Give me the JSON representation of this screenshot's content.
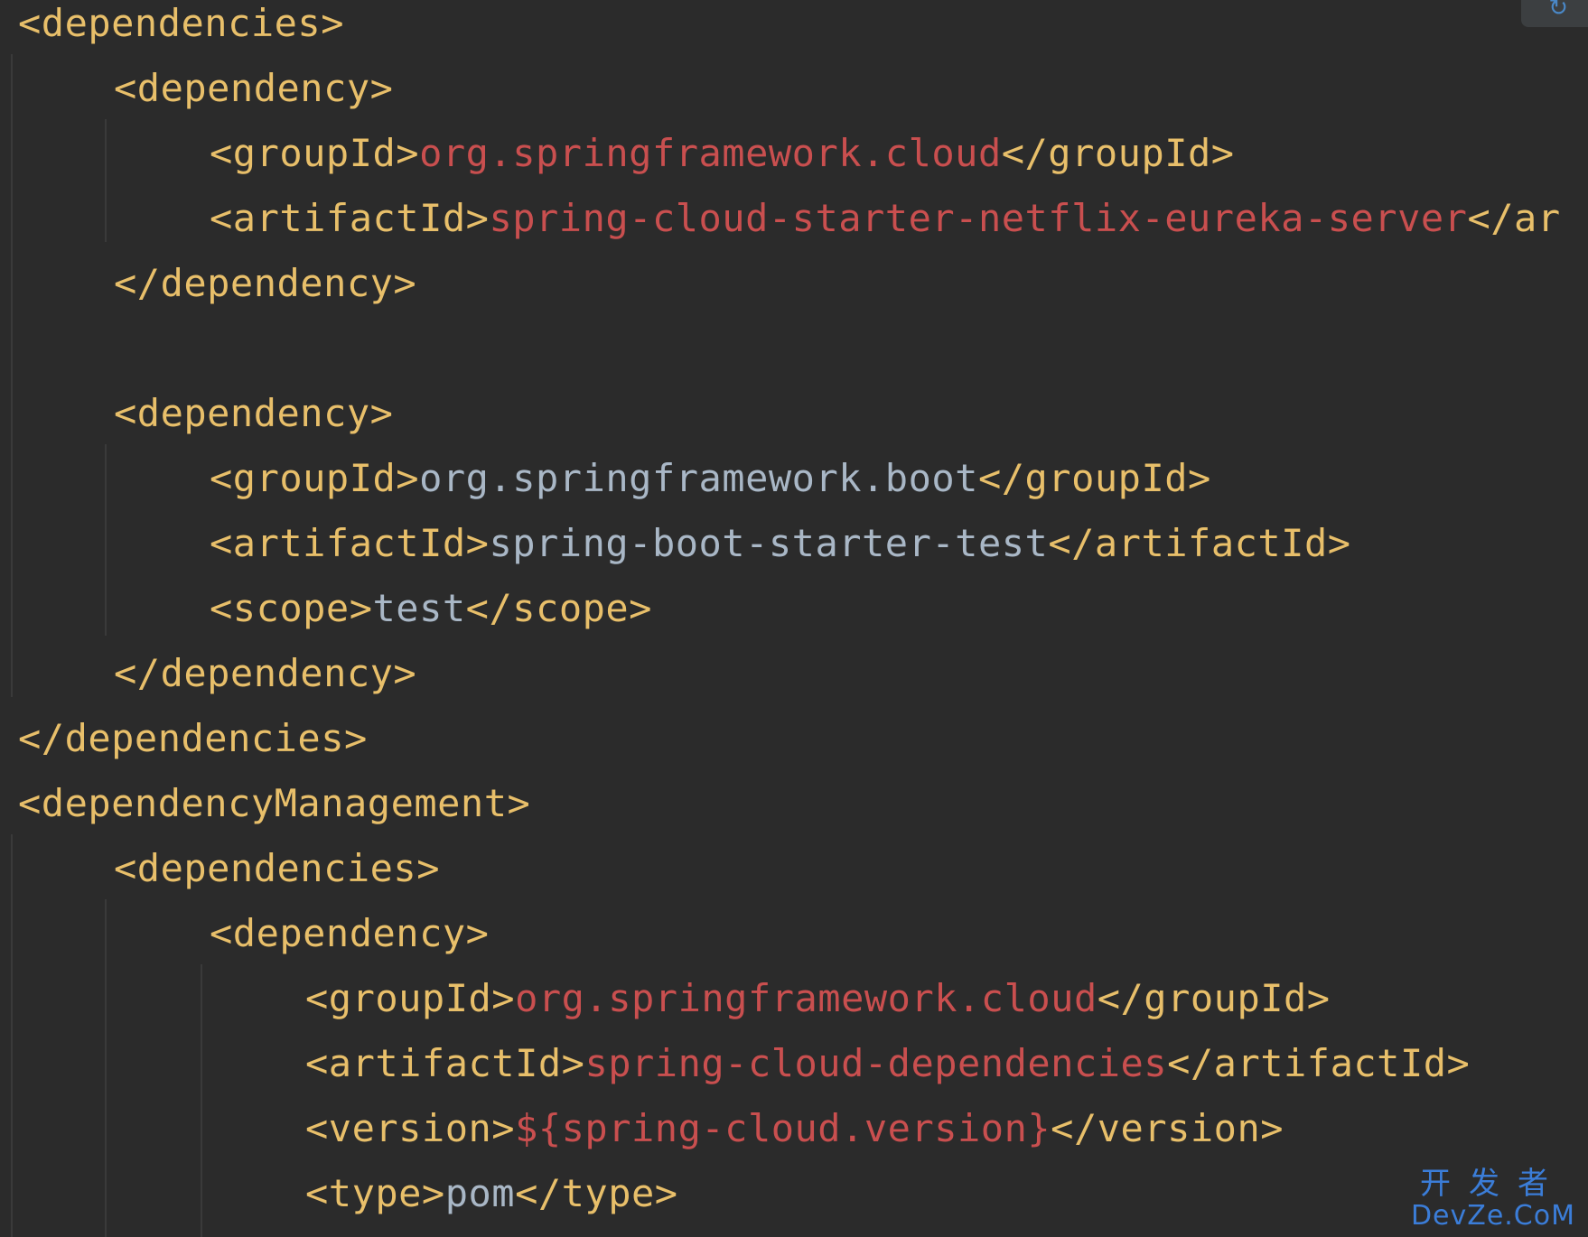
{
  "editor": {
    "colors": {
      "background": "#2b2b2b",
      "tag": "#e8bf6a",
      "unresolved": "#c94f4f",
      "text": "#a9b7c6"
    },
    "lines": [
      {
        "indent": 0,
        "parts": [
          {
            "t": "<dependencies>",
            "c": "tag"
          }
        ]
      },
      {
        "indent": 1,
        "parts": [
          {
            "t": "<dependency>",
            "c": "tag"
          }
        ]
      },
      {
        "indent": 2,
        "parts": [
          {
            "t": "<groupId>",
            "c": "tag"
          },
          {
            "t": "org.springframework.cloud",
            "c": "bad"
          },
          {
            "t": "</groupId>",
            "c": "tag"
          }
        ]
      },
      {
        "indent": 2,
        "parts": [
          {
            "t": "<artifactId>",
            "c": "tag"
          },
          {
            "t": "spring-cloud-starter-netflix-eureka-server",
            "c": "bad"
          },
          {
            "t": "</ar",
            "c": "tag"
          }
        ]
      },
      {
        "indent": 1,
        "parts": [
          {
            "t": "</dependency>",
            "c": "tag"
          }
        ]
      },
      {
        "indent": 0,
        "parts": []
      },
      {
        "indent": 1,
        "parts": [
          {
            "t": "<dependency>",
            "c": "tag"
          }
        ]
      },
      {
        "indent": 2,
        "parts": [
          {
            "t": "<groupId>",
            "c": "tag"
          },
          {
            "t": "org.springframework.boot",
            "c": "ok"
          },
          {
            "t": "</groupId>",
            "c": "tag"
          }
        ]
      },
      {
        "indent": 2,
        "parts": [
          {
            "t": "<artifactId>",
            "c": "tag"
          },
          {
            "t": "spring-boot-starter-test",
            "c": "ok"
          },
          {
            "t": "</artifactId>",
            "c": "tag"
          }
        ]
      },
      {
        "indent": 2,
        "parts": [
          {
            "t": "<scope>",
            "c": "tag"
          },
          {
            "t": "test",
            "c": "ok"
          },
          {
            "t": "</scope>",
            "c": "tag"
          }
        ]
      },
      {
        "indent": 1,
        "parts": [
          {
            "t": "</dependency>",
            "c": "tag"
          }
        ]
      },
      {
        "indent": 0,
        "parts": [
          {
            "t": "</dependencies>",
            "c": "tag"
          }
        ]
      },
      {
        "indent": 0,
        "parts": [
          {
            "t": "<dependencyManagement>",
            "c": "tag"
          }
        ]
      },
      {
        "indent": 1,
        "parts": [
          {
            "t": "<dependencies>",
            "c": "tag"
          }
        ]
      },
      {
        "indent": 2,
        "parts": [
          {
            "t": "<dependency>",
            "c": "tag"
          }
        ]
      },
      {
        "indent": 3,
        "parts": [
          {
            "t": "<groupId>",
            "c": "tag"
          },
          {
            "t": "org.springframework.cloud",
            "c": "bad"
          },
          {
            "t": "</groupId>",
            "c": "tag"
          }
        ]
      },
      {
        "indent": 3,
        "parts": [
          {
            "t": "<artifactId>",
            "c": "tag"
          },
          {
            "t": "spring-cloud-dependencies",
            "c": "bad"
          },
          {
            "t": "</artifactId>",
            "c": "tag"
          }
        ]
      },
      {
        "indent": 3,
        "parts": [
          {
            "t": "<version>",
            "c": "tag"
          },
          {
            "t": "${spring-cloud.version}",
            "c": "bad"
          },
          {
            "t": "</version>",
            "c": "tag"
          }
        ]
      },
      {
        "indent": 3,
        "parts": [
          {
            "t": "<type>",
            "c": "tag"
          },
          {
            "t": "pom",
            "c": "ok"
          },
          {
            "t": "</type>",
            "c": "tag"
          }
        ]
      }
    ]
  },
  "corner_widget": {
    "icon": "refresh-icon"
  },
  "watermark": {
    "cn": "开发者",
    "en": "DevZe.CoM"
  }
}
